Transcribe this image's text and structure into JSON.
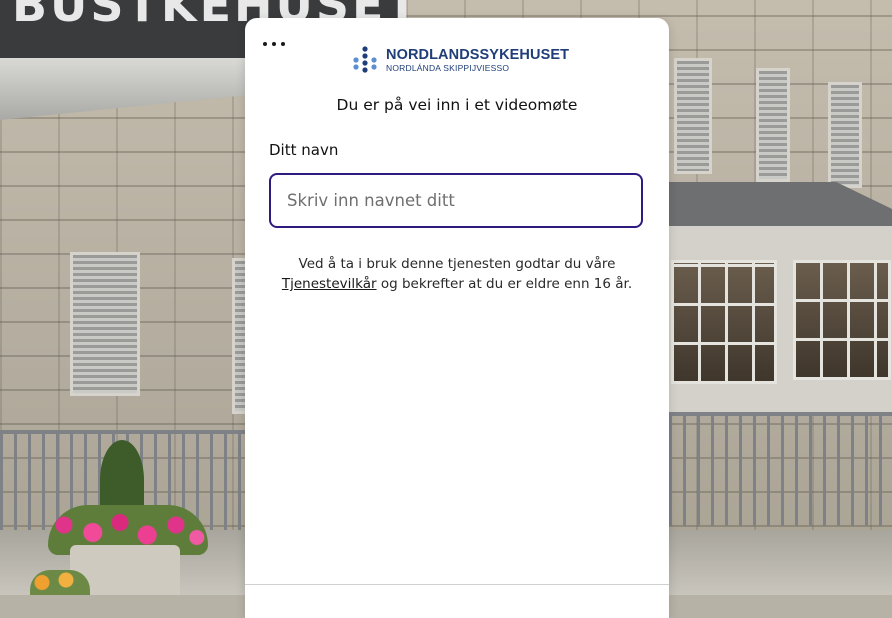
{
  "background": {
    "sign_text": "BUSTKEHUSET"
  },
  "dialog": {
    "more_icon": "more-horizontal-icon",
    "logo": {
      "name": "NORDLANDSSYKEHUSET",
      "subtitle": "NORDLÁNDA SKIPPIJVIESSO",
      "icon": "cross-dots-logo-icon",
      "color": "#1f3d78"
    },
    "heading": "Du er på vei inn i et videomøte",
    "name_field": {
      "label": "Ditt navn",
      "placeholder": "Skriv inn navnet ditt",
      "value": "",
      "border_color": "#2f1a80"
    },
    "terms": {
      "prefix": "Ved å ta i bruk denne tjenesten godtar du våre",
      "link": "Tjenestevilkår",
      "suffix": " og bekrefter at du er eldre enn 16 år."
    }
  }
}
